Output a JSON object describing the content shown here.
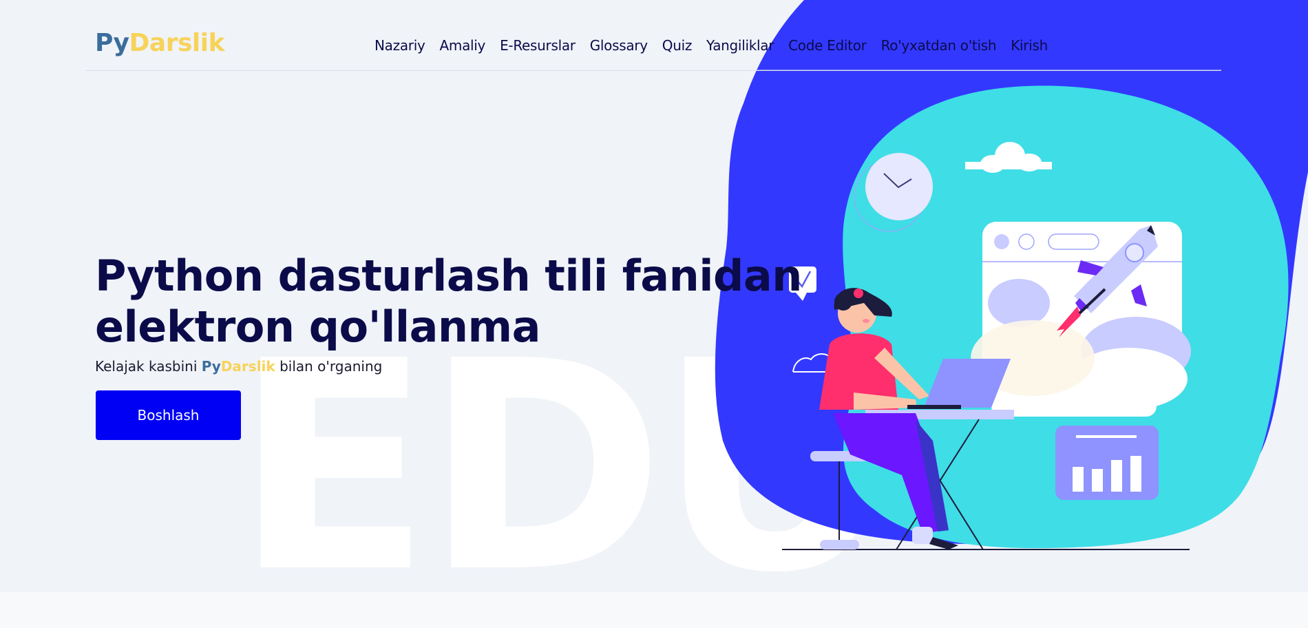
{
  "logo": {
    "part1": "Py",
    "part2": "Darslik"
  },
  "nav": {
    "items": [
      "Nazariy",
      "Amaliy",
      "E-Resurslar",
      "Glossary",
      "Quiz",
      "Yangiliklar",
      "Code Editor",
      "Ro'yxatdan o'tish",
      "Kirish"
    ]
  },
  "hero": {
    "title_line1": "Python dasturlash tili fanidan",
    "title_line2": "elektron qo'llanma",
    "subtitle_pre": "Kelajak kasbini ",
    "subtitle_brand1": "Py",
    "subtitle_brand2": "Darslik",
    "subtitle_post": " bilan o'rganing",
    "cta_label": "Boshlash",
    "watermark": "EDU"
  },
  "colors": {
    "brand_blue": "#3b6d9c",
    "brand_yellow": "#f7d35a",
    "primary_button": "#0000f5",
    "blob_blue": "#3338ff",
    "blob_cyan": "#3fdde6"
  },
  "icons": [
    "clock-icon",
    "checkmark-icon",
    "rocket-icon",
    "bar-chart-icon",
    "cloud-icon"
  ]
}
